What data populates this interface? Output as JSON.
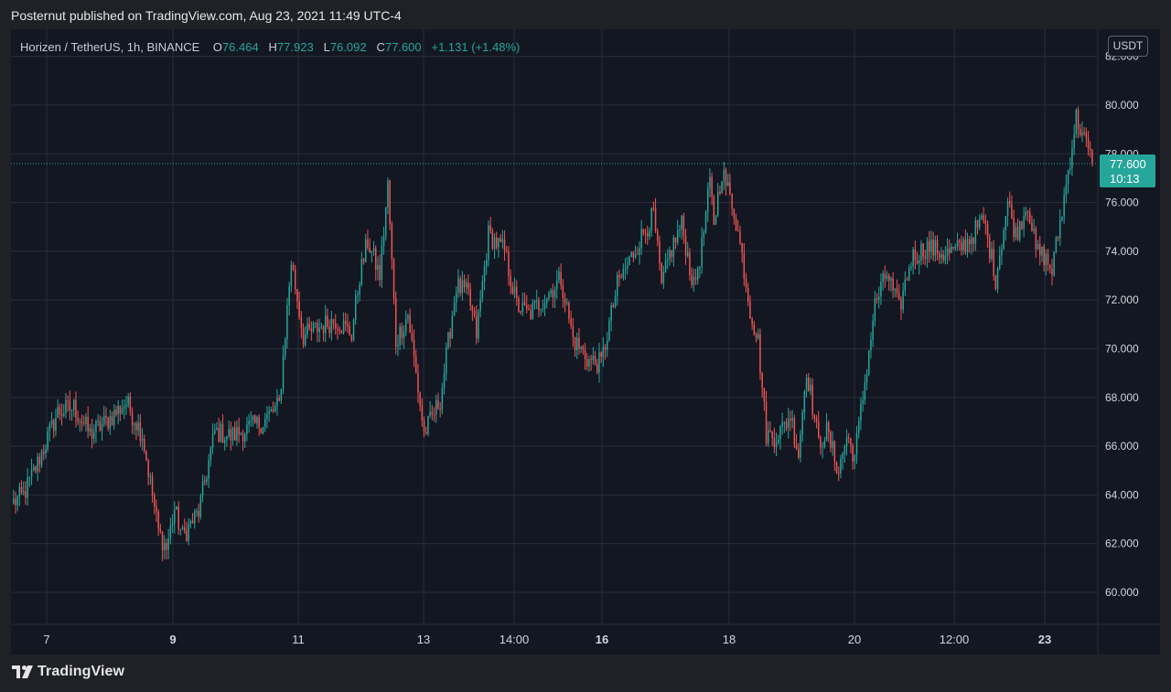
{
  "header": {
    "published_text": "Posternut published on TradingView.com, Aug 23, 2021 11:49 UTC-4"
  },
  "legend": {
    "symbol": "Horizen / TetherUS, 1h, BINANCE",
    "open_label": "O",
    "open": "76.464",
    "high_label": "H",
    "high": "77.923",
    "low_label": "L",
    "low": "76.092",
    "close_label": "C",
    "close": "77.600",
    "change": "+1.131 (+1.48%)"
  },
  "currency_button": "USDT",
  "price_tag": {
    "price": "77.600",
    "countdown": "10:13"
  },
  "footer": {
    "brand": "TradingView"
  },
  "colors": {
    "up": "#26a69a",
    "down": "#ef5350",
    "background": "#131722",
    "grid": "#2a2e39"
  },
  "chart_data": {
    "type": "candlestick",
    "interval": "1h",
    "y_axis": {
      "ticks": [
        "60.000",
        "62.000",
        "64.000",
        "66.000",
        "68.000",
        "70.000",
        "72.000",
        "74.000",
        "76.000",
        "78.000",
        "80.000",
        "82.000"
      ],
      "range": [
        58.8,
        83.0
      ]
    },
    "x_axis": {
      "ticks": [
        {
          "label": "7",
          "bold": false
        },
        {
          "label": "9",
          "bold": true
        },
        {
          "label": "11",
          "bold": false
        },
        {
          "label": "13",
          "bold": false
        },
        {
          "label": "14:00",
          "bold": false
        },
        {
          "label": "16",
          "bold": true
        },
        {
          "label": "18",
          "bold": false
        },
        {
          "label": "20",
          "bold": false
        },
        {
          "label": "12:00",
          "bold": false
        },
        {
          "label": "23",
          "bold": true
        }
      ]
    },
    "last_price": 77.6,
    "path_anchors": [
      [
        0,
        63.7
      ],
      [
        5,
        64.0
      ],
      [
        12,
        65.3
      ],
      [
        22,
        67.4
      ],
      [
        30,
        67.6
      ],
      [
        38,
        66.5
      ],
      [
        46,
        67.0
      ],
      [
        56,
        67.8
      ],
      [
        64,
        66.5
      ],
      [
        72,
        62.5
      ],
      [
        76,
        61.8
      ],
      [
        80,
        63.4
      ],
      [
        84,
        62.3
      ],
      [
        92,
        63.3
      ],
      [
        100,
        66.6
      ],
      [
        108,
        66.4
      ],
      [
        116,
        66.7
      ],
      [
        124,
        67.0
      ],
      [
        132,
        67.7
      ],
      [
        138,
        73.6
      ],
      [
        144,
        70.5
      ],
      [
        152,
        70.9
      ],
      [
        160,
        71.2
      ],
      [
        168,
        70.6
      ],
      [
        172,
        73.0
      ],
      [
        176,
        74.4
      ],
      [
        182,
        73.0
      ],
      [
        186,
        76.7
      ],
      [
        190,
        70.3
      ],
      [
        196,
        71.4
      ],
      [
        204,
        66.5
      ],
      [
        212,
        67.9
      ],
      [
        220,
        72.6
      ],
      [
        226,
        72.2
      ],
      [
        230,
        70.6
      ],
      [
        236,
        74.7
      ],
      [
        244,
        74.0
      ],
      [
        250,
        71.8
      ],
      [
        256,
        71.4
      ],
      [
        264,
        72.1
      ],
      [
        272,
        72.9
      ],
      [
        278,
        70.4
      ],
      [
        286,
        69.5
      ],
      [
        292,
        69.4
      ],
      [
        300,
        72.6
      ],
      [
        306,
        73.6
      ],
      [
        312,
        74.6
      ],
      [
        318,
        75.5
      ],
      [
        322,
        72.5
      ],
      [
        326,
        73.9
      ],
      [
        332,
        75.1
      ],
      [
        338,
        72.5
      ],
      [
        342,
        74.2
      ],
      [
        346,
        76.8
      ],
      [
        348,
        75.2
      ],
      [
        352,
        77.3
      ],
      [
        358,
        75.7
      ],
      [
        362,
        73.8
      ],
      [
        366,
        71.6
      ],
      [
        370,
        70.3
      ],
      [
        374,
        66.5
      ],
      [
        378,
        66.4
      ],
      [
        382,
        66.7
      ],
      [
        386,
        67.3
      ],
      [
        390,
        65.7
      ],
      [
        394,
        69.2
      ],
      [
        400,
        66.1
      ],
      [
        404,
        66.6
      ],
      [
        410,
        65.0
      ],
      [
        414,
        66.4
      ],
      [
        418,
        65.6
      ],
      [
        422,
        68.0
      ],
      [
        428,
        71.8
      ],
      [
        434,
        73.1
      ],
      [
        440,
        71.6
      ],
      [
        446,
        73.7
      ],
      [
        454,
        74.2
      ],
      [
        462,
        73.9
      ],
      [
        468,
        74.0
      ],
      [
        474,
        74.4
      ],
      [
        482,
        75.3
      ],
      [
        488,
        72.9
      ],
      [
        494,
        76.0
      ],
      [
        498,
        74.7
      ],
      [
        504,
        76.0
      ],
      [
        508,
        74.0
      ],
      [
        512,
        73.8
      ],
      [
        516,
        73.2
      ],
      [
        522,
        76.2
      ],
      [
        528,
        79.5
      ],
      [
        532,
        78.6
      ],
      [
        536,
        77.6
      ]
    ]
  }
}
